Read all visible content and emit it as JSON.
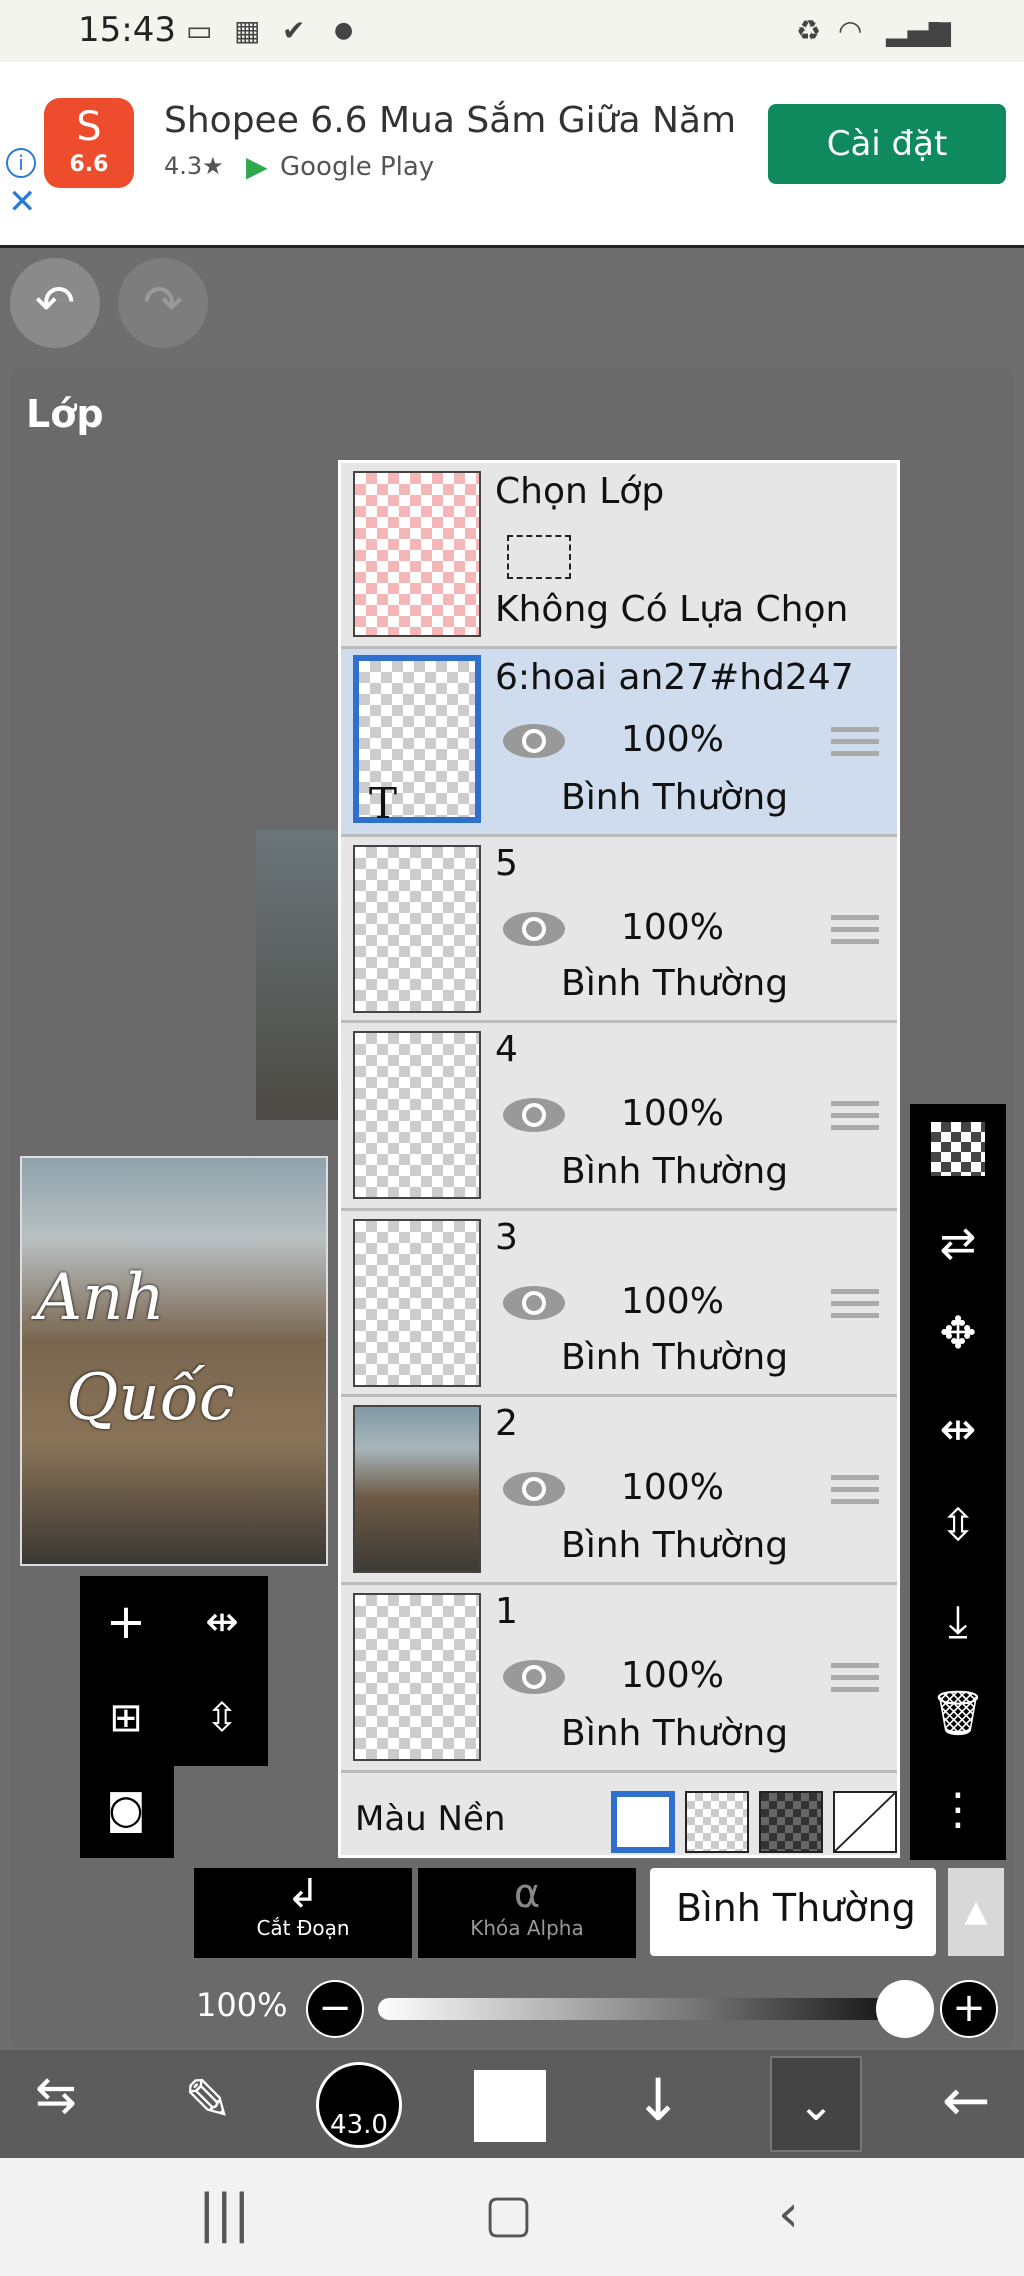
{
  "status_bar": {
    "time": "15:43"
  },
  "ad": {
    "app_title": "Shopee 6.6 Mua Sắm Giữa Năm",
    "icon_label": "6.6",
    "rating": "4.3★",
    "store": "Google Play",
    "install_label": "Cài đặt"
  },
  "panel": {
    "title": "Lớp"
  },
  "selection_row": {
    "title": "Chọn Lớp",
    "subtitle": "Không Có Lựa Chọn"
  },
  "layers": [
    {
      "name": "6:hoai an27#hd247",
      "opacity": "100%",
      "blend": "Bình Thường",
      "selected": true
    },
    {
      "name": "5",
      "opacity": "100%",
      "blend": "Bình Thường",
      "selected": false
    },
    {
      "name": "4",
      "opacity": "100%",
      "blend": "Bình Thường",
      "selected": false
    },
    {
      "name": "3",
      "opacity": "100%",
      "blend": "Bình Thường",
      "selected": false
    },
    {
      "name": "2",
      "opacity": "100%",
      "blend": "Bình Thường",
      "selected": false
    },
    {
      "name": "1",
      "opacity": "100%",
      "blend": "Bình Thường",
      "selected": false
    }
  ],
  "text_layer_marker": "T",
  "background": {
    "label": "Màu Nền"
  },
  "preview": {
    "art_line1": "Anh",
    "art_line2": "Quốc"
  },
  "bottom": {
    "clip_label": "Cắt Đoạn",
    "alpha_lock_label": "Khóa Alpha",
    "blend_mode": "Bình Thường",
    "opacity_label": "100%",
    "brush_size": "43.0"
  }
}
